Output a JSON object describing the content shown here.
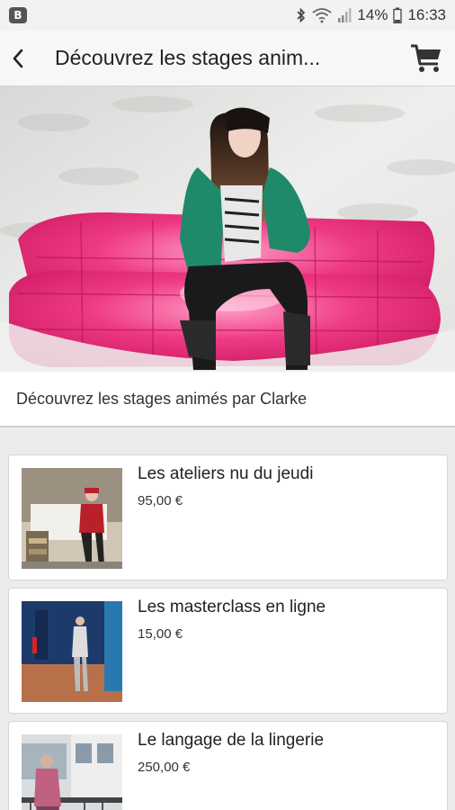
{
  "status_bar": {
    "app_badge": "B",
    "battery": "14%",
    "time": "16:33",
    "icons": [
      "bluetooth-icon",
      "wifi-icon",
      "signal-icon",
      "battery-icon"
    ]
  },
  "app_bar": {
    "title": "Découvrez les stages anim...",
    "back_icon": "chevron-left-icon",
    "cart_icon": "shopping-cart-icon"
  },
  "hero": {
    "image": "woman-in-green-jacket-on-pink-sofa"
  },
  "intro": {
    "text": "Découvrez les stages animés par Clarke"
  },
  "products": [
    {
      "title": "Les ateliers nu du jeudi",
      "price": "95,00 €",
      "image": "model-on-white-sofa-with-books"
    },
    {
      "title": "Les masterclass en ligne",
      "price": "15,00 €",
      "image": "model-in-blue-room"
    },
    {
      "title": "Le langage de la lingerie",
      "price": "250,00 €",
      "image": "model-on-balcony"
    }
  ],
  "colors": {
    "background": "#ececec",
    "card": "#ffffff",
    "sofa_pink": "#e8246e",
    "jacket_green": "#1f8a6a"
  }
}
